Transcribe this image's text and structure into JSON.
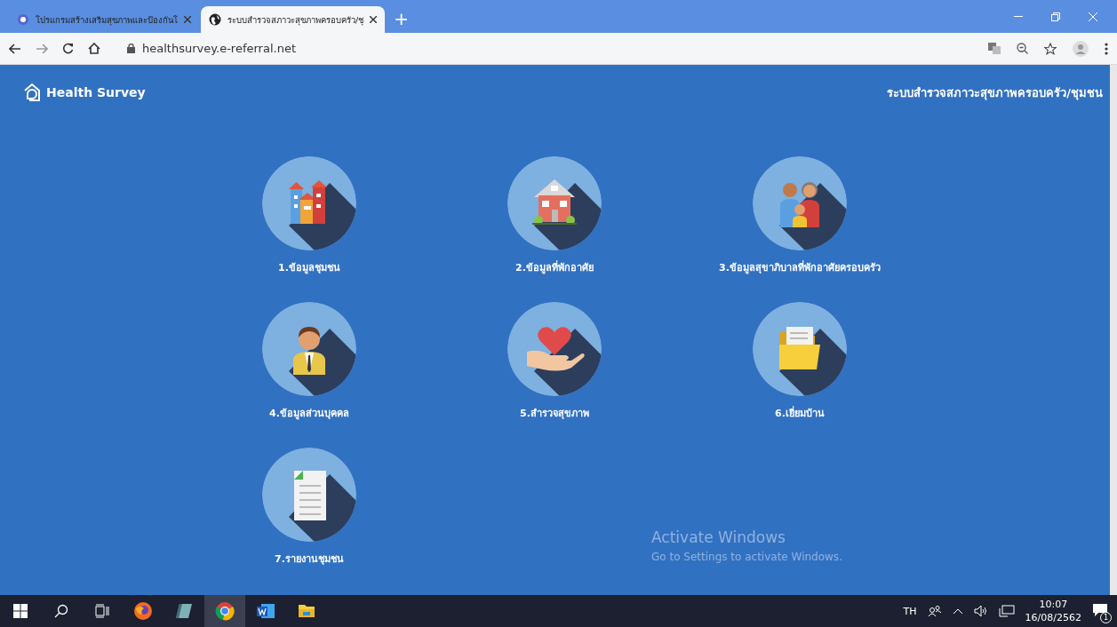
{
  "browser": {
    "tabs": [
      {
        "title": "โปรแกรมสร้างเสริมสุขภาพและป้องกันโ",
        "selected": false,
        "kind": "emblem"
      },
      {
        "title": "ระบบสำรวจสภาวะสุขภาพครอบครัว/ชุ",
        "selected": true,
        "kind": "globe"
      }
    ],
    "new_tab": "+",
    "url": "healthsurvey.e-referral.net"
  },
  "page": {
    "brand": "Health Survey",
    "system_title": "ระบบสำรวจสภาวะสุขภาพครอบครัว/ชุมชน",
    "menu": [
      {
        "label": "1.ข้อมูลชุมชน",
        "kind": "buildings"
      },
      {
        "label": "2.ข้อมูลที่พักอาศัย",
        "kind": "house"
      },
      {
        "label": "3.ข้อมูลสุขาภิบาลที่พักอาศัยครอบครัว",
        "kind": "family"
      },
      {
        "label": "4.ข้อมูลส่วนบุคคล",
        "kind": "person"
      },
      {
        "label": "5.สำรวจสุขภาพ",
        "kind": "heart"
      },
      {
        "label": "6.เยี่ยมบ้าน",
        "kind": "folder"
      },
      {
        "label": "7.รายงานชุมชน",
        "kind": "document"
      }
    ],
    "activation": {
      "title": "Activate Windows",
      "hint": "Go to Settings to activate Windows."
    }
  },
  "taskbar": {
    "apps": [
      {
        "kind": "firefox",
        "selected": false
      },
      {
        "kind": "notes",
        "selected": false
      },
      {
        "kind": "chrome",
        "selected": true
      },
      {
        "kind": "word",
        "selected": false
      },
      {
        "kind": "explorer",
        "selected": false
      }
    ],
    "language": "TH",
    "time": "10:07",
    "date": "16/08/2562",
    "notifications": "1"
  }
}
